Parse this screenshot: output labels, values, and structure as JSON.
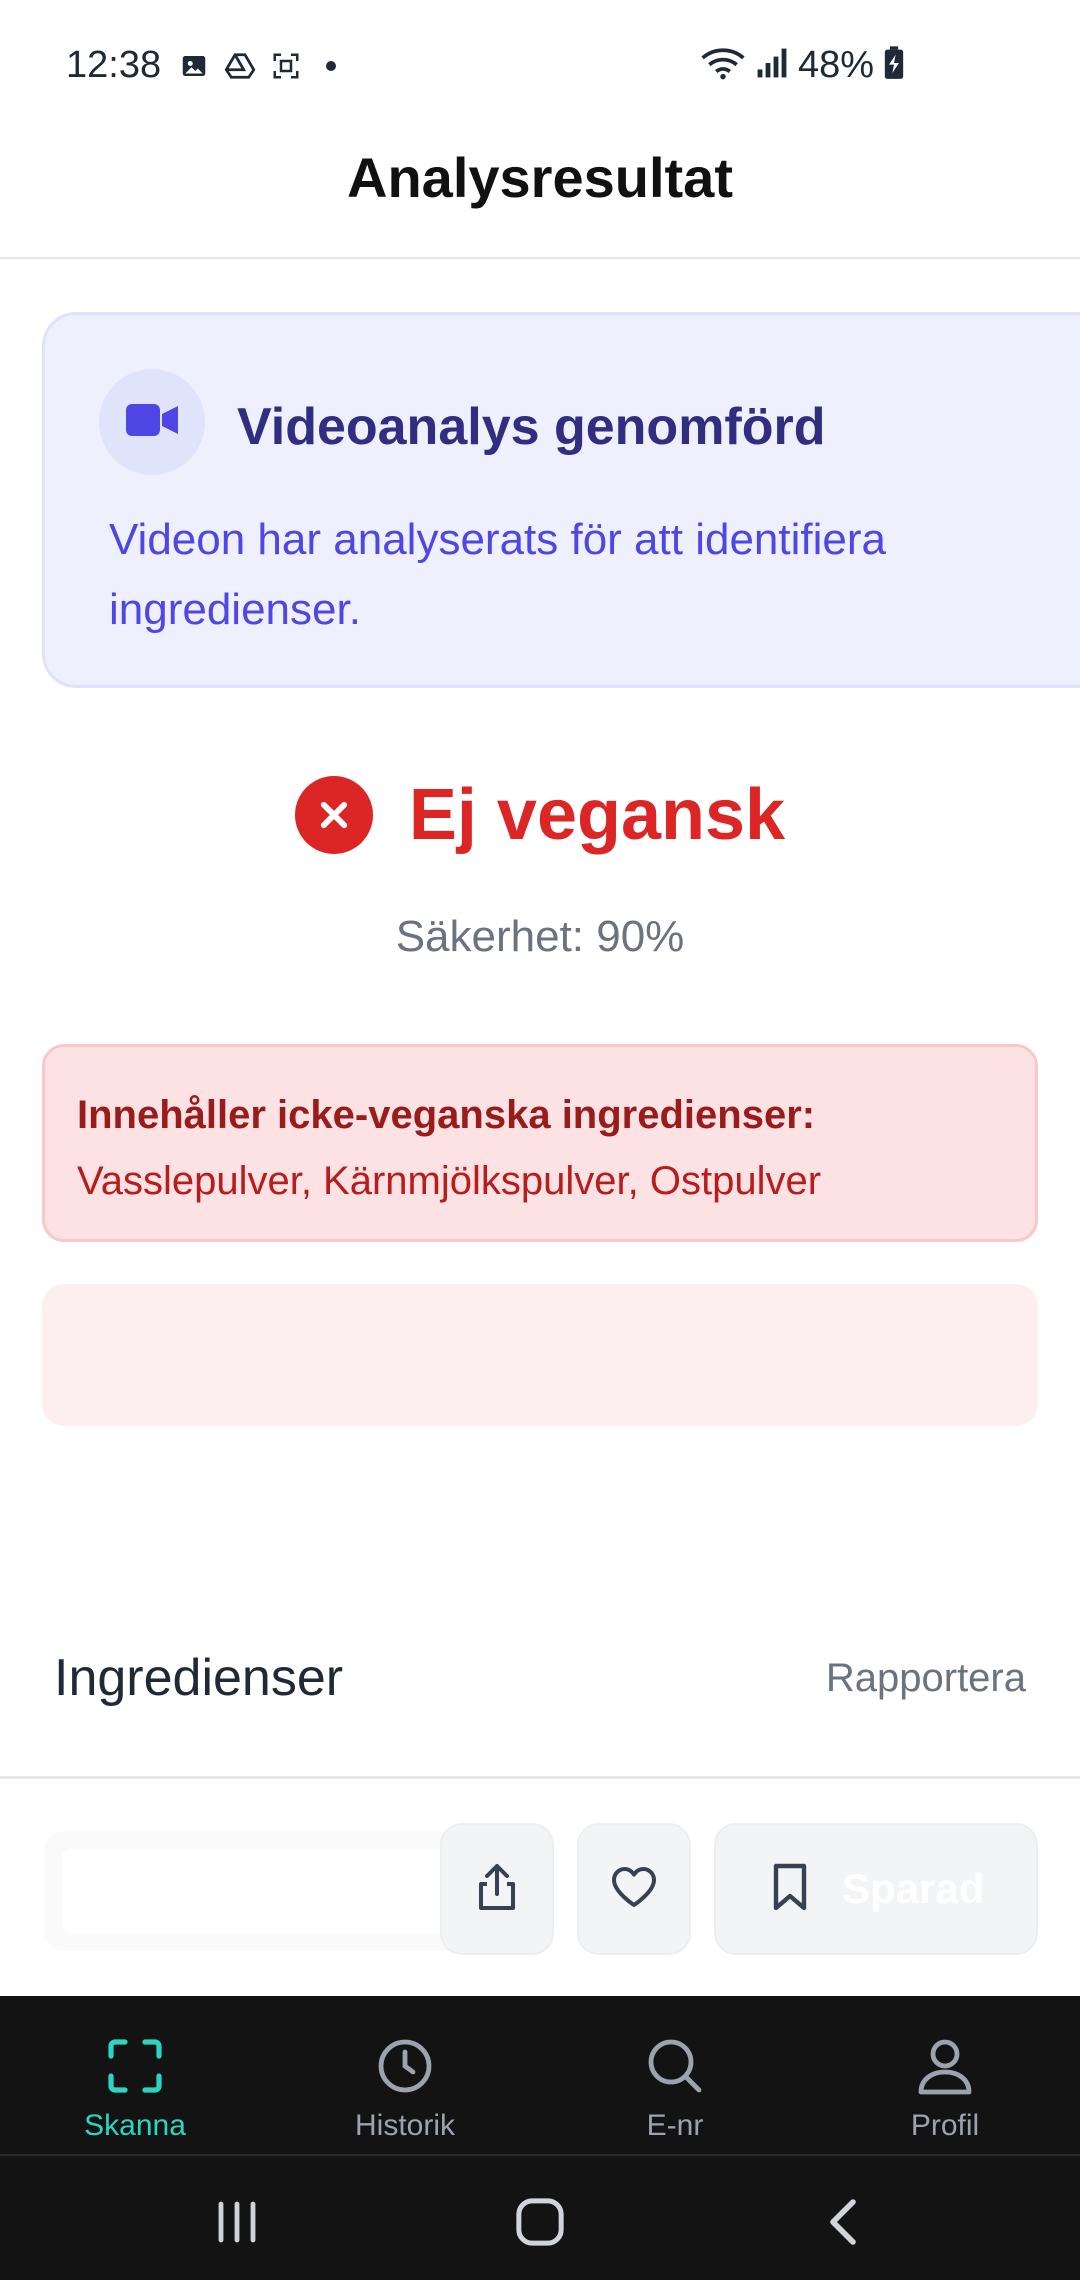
{
  "status_bar": {
    "time": "12:38",
    "battery": "48%",
    "icons_left": [
      "gallery-icon",
      "drive-icon",
      "screenshot-icon"
    ],
    "icons_right": [
      "wifi-icon",
      "signal-icon",
      "battery-charging-icon"
    ]
  },
  "header": {
    "title": "Analysresultat"
  },
  "video_card": {
    "icon": "video-camera-icon",
    "title": "Videoanalys genomförd",
    "description": "Videon har analyserats för att identifiera ingredienser."
  },
  "verdict": {
    "icon": "x-circle-icon",
    "label": "Ej vegansk",
    "confidence": "Säkerhet: 90%",
    "color": "#dc2626"
  },
  "warning": {
    "title": "Innehåller icke-veganska ingredienser:",
    "items": "Vasslepulver, Kärnmjölkspulver, Ostpulver"
  },
  "ingredients": {
    "title": "Ingredienser",
    "report_label": "Rapportera"
  },
  "actions": {
    "save_label": "Sparad",
    "share_icon": "share-icon",
    "like_icon": "heart-icon",
    "save_icon": "bookmark-icon"
  },
  "bottom_nav": {
    "items": [
      {
        "label": "Skanna",
        "icon": "scan-icon",
        "active": true
      },
      {
        "label": "Historik",
        "icon": "clock-icon",
        "active": false
      },
      {
        "label": "E-nr",
        "icon": "search-icon",
        "active": false
      },
      {
        "label": "Profil",
        "icon": "user-icon",
        "active": false
      }
    ],
    "active_color": "#2dd4bf"
  },
  "system_nav": [
    "recents-icon",
    "home-icon",
    "back-icon"
  ]
}
